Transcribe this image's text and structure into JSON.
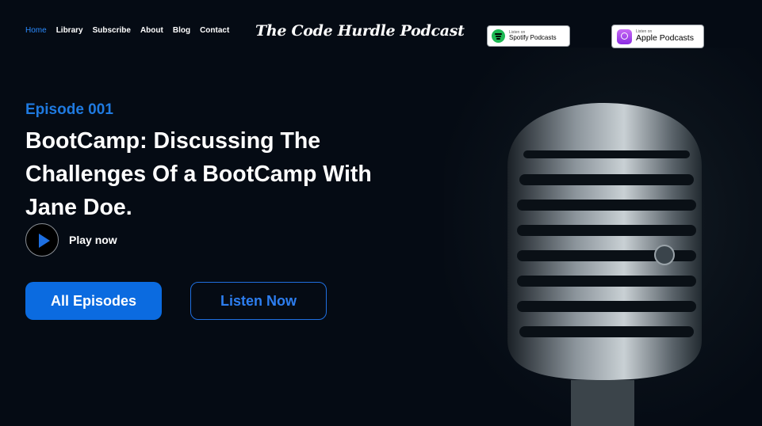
{
  "nav": {
    "items": [
      {
        "label": "Home",
        "active": true
      },
      {
        "label": "Library",
        "active": false
      },
      {
        "label": "Subscribe",
        "active": false
      },
      {
        "label": "About",
        "active": false
      },
      {
        "label": "Blog",
        "active": false
      },
      {
        "label": "Contact",
        "active": false
      }
    ]
  },
  "brand": {
    "title": "The Code Hurdle Podcast"
  },
  "badges": {
    "spotify": {
      "small": "Listen on",
      "big": "Spotify Podcasts",
      "icon": "spotify-icon"
    },
    "apple": {
      "small": "Listen on",
      "big": "Apple Podcasts",
      "icon": "apple-podcasts-icon"
    }
  },
  "hero": {
    "episode": "Episode 001",
    "title": "BootCamp: Discussing The Challenges Of a BootCamp With Jane Doe.",
    "play_label": "Play now",
    "play_icon": "play-icon",
    "all_episodes": "All Episodes",
    "listen_now": "Listen Now"
  },
  "colors": {
    "accent": "#0b6be0",
    "background": "#050b14",
    "active_nav": "#2a8bff"
  }
}
